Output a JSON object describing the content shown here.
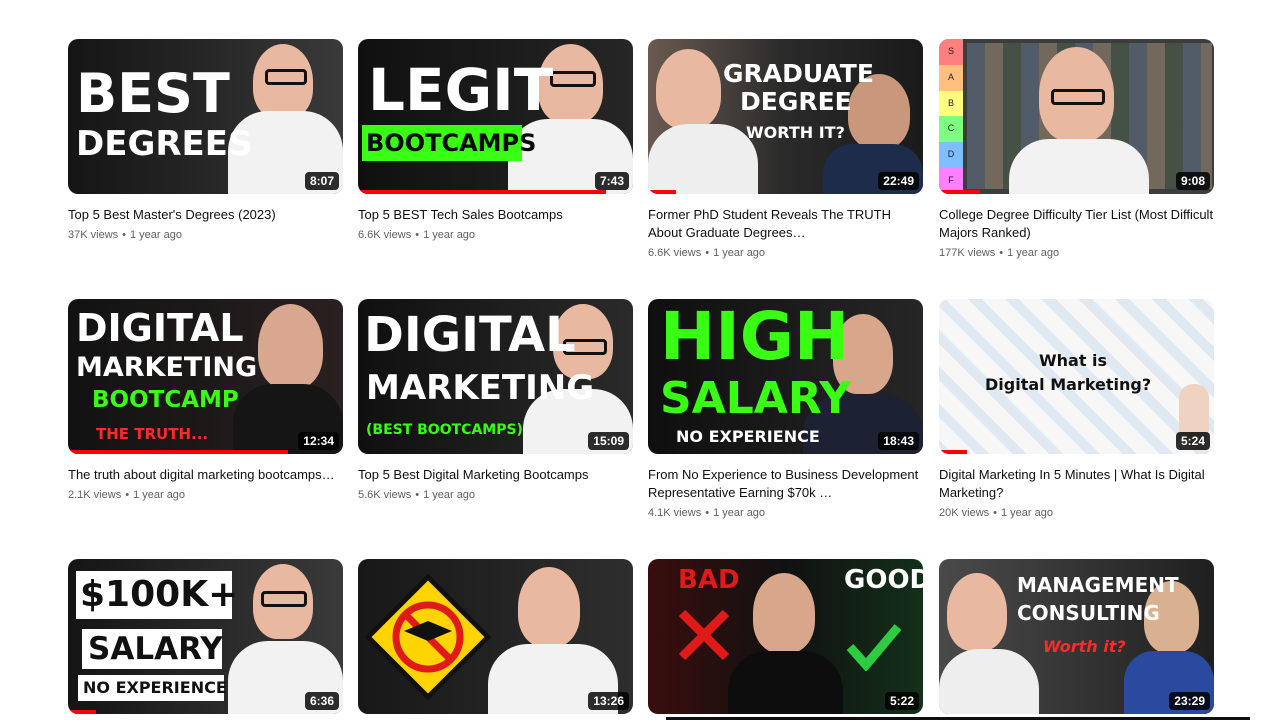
{
  "videos": [
    {
      "title": "Top 5 Best Master's Degrees (2023)",
      "views": "37K views",
      "age": "1 year ago",
      "duration": "8:07",
      "progress": 0,
      "thumb": {
        "lines": [
          "BEST",
          "DEGREES"
        ]
      }
    },
    {
      "title": "Top 5 BEST Tech Sales Bootcamps",
      "views": "6.6K views",
      "age": "1 year ago",
      "duration": "7:43",
      "progress": 0.9,
      "thumb": {
        "lines": [
          "LEGIT",
          "BOOTCAMPS"
        ]
      }
    },
    {
      "title": "Former PhD Student Reveals The TRUTH About Graduate Degrees…",
      "views": "6.6K views",
      "age": "1 year ago",
      "duration": "22:49",
      "progress": 0.1,
      "thumb": {
        "lines": [
          "GRADUATE",
          "DEGREE",
          "WORTH IT?"
        ]
      }
    },
    {
      "title": "College Degree Difficulty Tier List (Most Difficult Majors Ranked)",
      "views": "177K views",
      "age": "1 year ago",
      "duration": "9:08",
      "progress": 0.15,
      "thumb": {
        "lines": [
          "S",
          "A",
          "B",
          "C",
          "D",
          "F"
        ]
      }
    },
    {
      "title": "The truth about digital marketing bootcamps…",
      "views": "2.1K views",
      "age": "1 year ago",
      "duration": "12:34",
      "progress": 0.8,
      "thumb": {
        "lines": [
          "DIGITAL",
          "MARKETING",
          "BOOTCAMP",
          "THE TRUTH..."
        ]
      }
    },
    {
      "title": "Top 5 Best Digital Marketing Bootcamps",
      "views": "5.6K views",
      "age": "1 year ago",
      "duration": "15:09",
      "progress": 0,
      "thumb": {
        "lines": [
          "DIGITAL",
          "MARKETING",
          "(BEST BOOTCAMPS)"
        ]
      }
    },
    {
      "title": "From No Experience to Business Development Representative Earning $70k …",
      "views": "4.1K views",
      "age": "1 year ago",
      "duration": "18:43",
      "progress": 0,
      "thumb": {
        "lines": [
          "HIGH",
          "SALARY",
          "NO EXPERIENCE"
        ]
      }
    },
    {
      "title": "Digital Marketing In 5 Minutes | What Is Digital Marketing?",
      "views": "20K views",
      "age": "1 year ago",
      "duration": "5:24",
      "progress": 0.1,
      "thumb": {
        "lines": [
          "What is",
          "Digital Marketing?"
        ]
      }
    },
    {
      "title": "",
      "views": "",
      "age": "",
      "duration": "6:36",
      "progress": 0.1,
      "thumb": {
        "lines": [
          "$100K+",
          "SALARY",
          "NO EXPERIENCE"
        ]
      }
    },
    {
      "title": "",
      "views": "",
      "age": "",
      "duration": "13:26",
      "progress": 0,
      "thumb": {
        "lines": []
      }
    },
    {
      "title": "",
      "views": "",
      "age": "",
      "duration": "5:22",
      "progress": 0,
      "thumb": {
        "lines": [
          "BAD",
          "GOOD"
        ]
      }
    },
    {
      "title": "",
      "views": "",
      "age": "",
      "duration": "23:29",
      "progress": 0,
      "thumb": {
        "lines": [
          "MANAGEMENT",
          "CONSULTING",
          "Worth it?"
        ]
      }
    }
  ],
  "colors": {
    "progress": "#ff0000",
    "title": "#0f0f0f",
    "meta": "#606060",
    "neon_green": "#39ff14"
  }
}
